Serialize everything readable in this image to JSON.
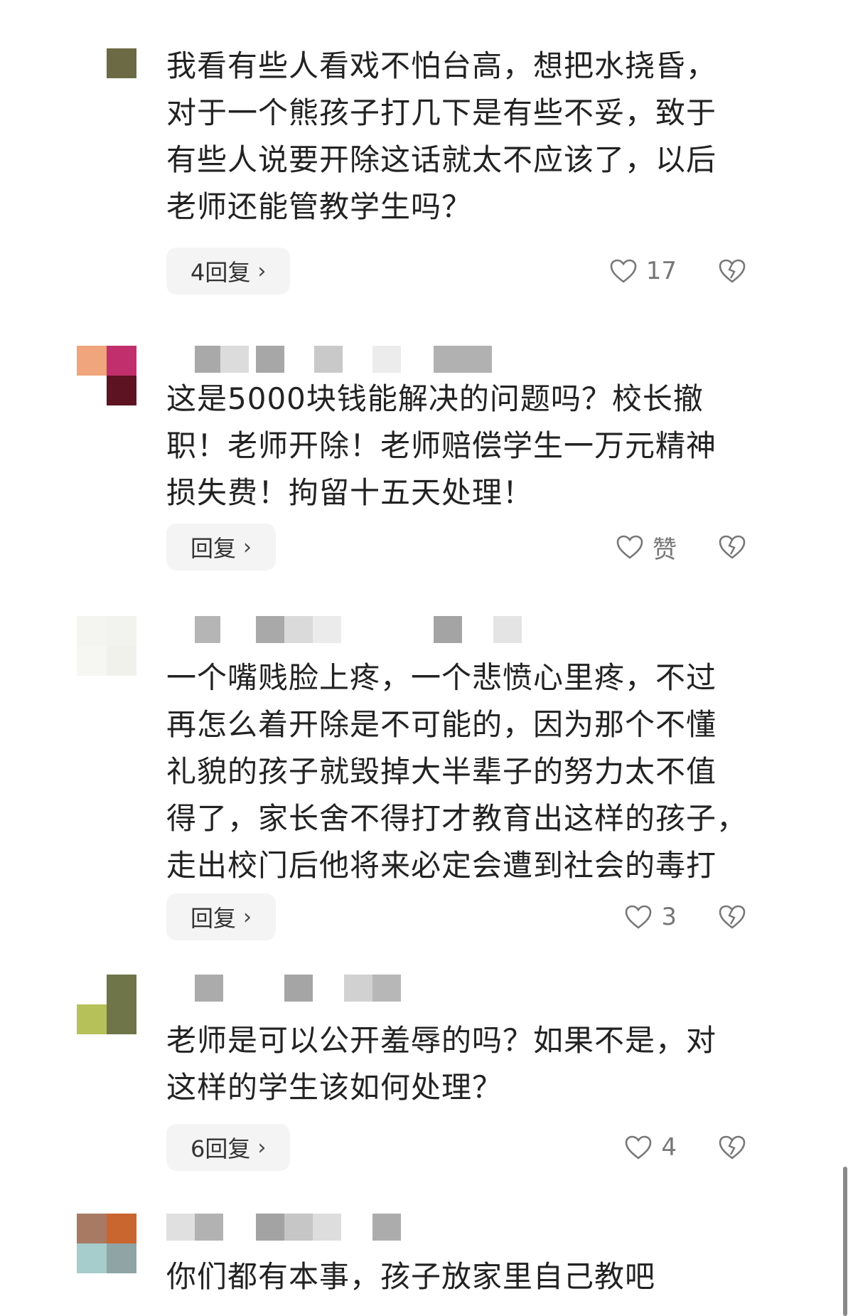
{
  "comments": [
    {
      "text": "我看有些人看戏不怕台高，想把水挠昏，\n对于一个熊孩子打几下是有些不妥，致于\n有些人说要开除这话就太不应该了，以后\n老师还能管教学生吗？",
      "reply_label": "4回复",
      "likes": "17",
      "avatar_colors": [
        "#ffffff",
        "#6b6a45",
        "#ffffff",
        "#ffffff"
      ]
    },
    {
      "text": "这是5000块钱能解决的问题吗？校长撤\n职！老师开除！老师赔偿学生一万元精神\n损失费！拘留十五天处理！",
      "reply_label": "回复",
      "likes": "赞",
      "avatar_colors": [
        "#f0a57c",
        "#c1306c",
        "#ffffff",
        "#5d1322"
      ]
    },
    {
      "text": "一个嘴贱脸上疼，一个悲愤心里疼，不过\n再怎么着开除是不可能的，因为那个不懂\n礼貌的孩子就毁掉大半辈子的努力太不值\n得了，家长舍不得打才教育出这样的孩子，\n走出校门后他将来必定会遭到社会的毒打",
      "reply_label": "回复",
      "likes": "3",
      "avatar_colors": [
        "#f4f4f1",
        "#f2f2ee",
        "#f6f6f3",
        "#f1f1ec"
      ]
    },
    {
      "text": "老师是可以公开羞辱的吗？如果不是，对\n这样的学生该如何处理？",
      "reply_label": "6回复",
      "likes": "4",
      "avatar_colors": [
        "#ffffff",
        "#6f7548",
        "#b7c15a",
        "#6f7548"
      ]
    },
    {
      "text": "你们都有本事，孩子放家里自己教吧",
      "avatar_colors": [
        "#a87a63",
        "#c9652e",
        "#a6cccc",
        "#8fa5a5"
      ]
    }
  ],
  "icons": {
    "like": "heart-outline-icon",
    "dislike": "broken-heart-icon",
    "chevron": "chevron-right-icon"
  },
  "colors": {
    "chip_bg": "#f4f4f4",
    "text": "#222222",
    "muted": "#777777"
  }
}
